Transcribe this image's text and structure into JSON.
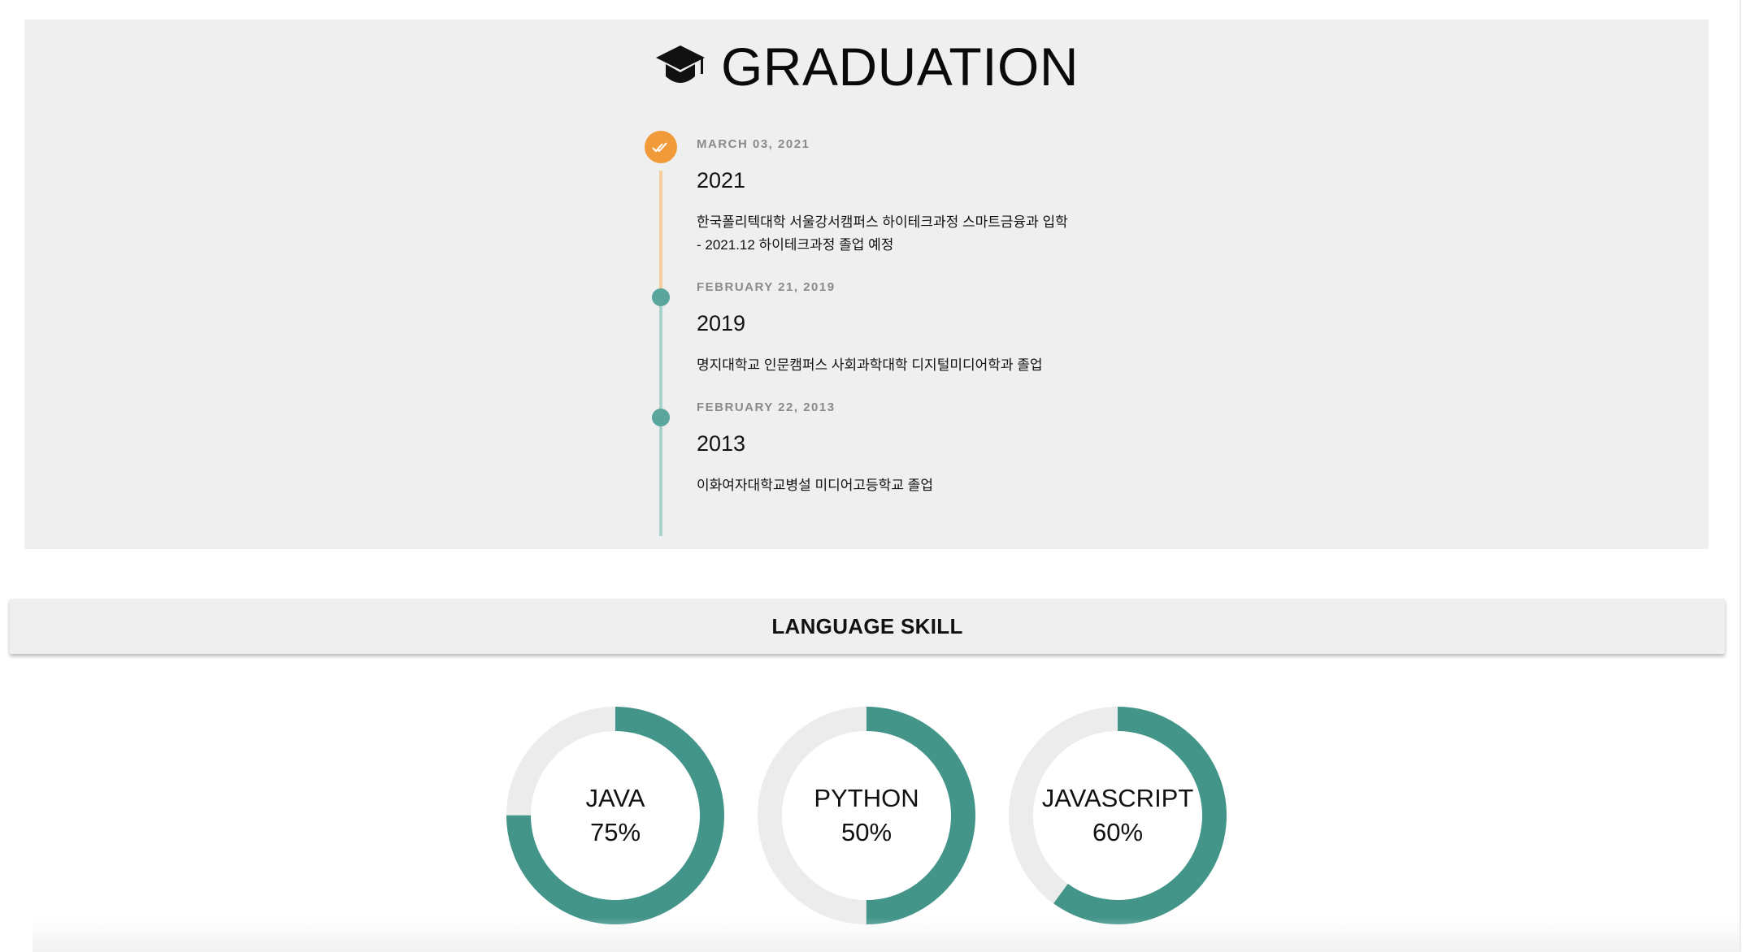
{
  "graduation": {
    "title": "GRADUATION",
    "icon": "graduation-cap-icon",
    "entries": [
      {
        "date": "MARCH 03, 2021",
        "year": "2021",
        "lines": [
          "한국폴리텍대학 서울강서캠퍼스 하이테크과정 스마트금융과 입학",
          "- 2021.12 하이테크과정 졸업 예정"
        ],
        "marker": "check-icon",
        "status": "current"
      },
      {
        "date": "FEBRUARY 21, 2019",
        "year": "2019",
        "lines": [
          "명지대학교 인문캠퍼스 사회과학대학 디지털미디어학과 졸업"
        ],
        "status": "done"
      },
      {
        "date": "FEBRUARY 22, 2013",
        "year": "2013",
        "lines": [
          "이화여자대학교병설 미디어고등학교 졸업"
        ],
        "status": "done"
      }
    ]
  },
  "skills": {
    "title": "LANGUAGE SKILL",
    "items": [
      {
        "name": "JAVA",
        "percent_label": "75%",
        "value": 0.75
      },
      {
        "name": "PYTHON",
        "percent_label": "50%",
        "value": 0.5
      },
      {
        "name": "JAVASCRIPT",
        "percent_label": "60%",
        "value": 0.6
      }
    ]
  },
  "colors": {
    "background": "#ffffff",
    "panel": "#efefef",
    "accent_orange": "#f09a3a",
    "timeline_orange_line": "#f3cfa0",
    "accent_teal": "#5aa59c",
    "timeline_teal_line": "#a9d2cd",
    "skill_fill": "#43958a",
    "skill_track": "#ececec",
    "date_gray": "#8a8a8a"
  }
}
